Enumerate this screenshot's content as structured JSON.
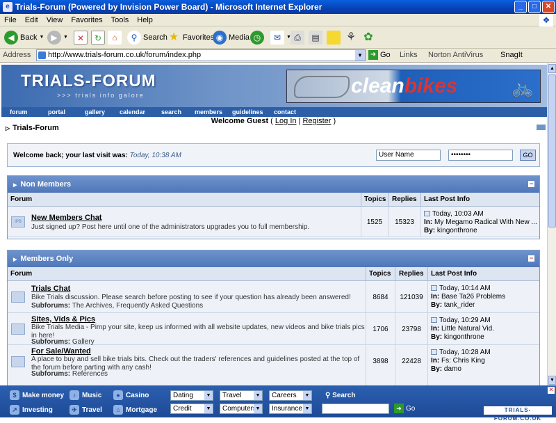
{
  "window": {
    "title": "Trials-Forum (Powered by Invision Power Board) - Microsoft Internet Explorer"
  },
  "menu": [
    "File",
    "Edit",
    "View",
    "Favorites",
    "Tools",
    "Help"
  ],
  "toolbar": {
    "back": "Back",
    "search": "Search",
    "favorites": "Favorites",
    "media": "Media"
  },
  "address": {
    "label": "Address",
    "url": "http://www.trials-forum.co.uk/forum/index.php",
    "go": "Go",
    "links": "Links",
    "norton": "Norton AntiVirus",
    "snagit": "SnagIt"
  },
  "banner": {
    "logo": "TRIALS-FORUM",
    "logo_sub": ">>> trials info galore",
    "ad_clean": "clean",
    "ad_bikes": "bikes"
  },
  "nav": [
    "forum",
    "portal",
    "gallery",
    "calendar",
    "search",
    "members",
    "guidelines",
    "contact"
  ],
  "guest": {
    "welcome": "Welcome Guest",
    "login": "Log In",
    "register": "Register"
  },
  "breadcrumb": "Trials-Forum",
  "login": {
    "msg": "Welcome back; your last visit was:",
    "last_visit": "Today, 10:38 AM",
    "username": "User Name",
    "password": "••••••••",
    "go": "GO"
  },
  "categories": [
    {
      "name": "Non Members",
      "columns": {
        "forum": "Forum",
        "topics": "Topics",
        "replies": "Replies",
        "last": "Last Post Info"
      },
      "forums": [
        {
          "title": "New Members Chat",
          "desc": "Just signed up? Post here until one of the administrators upgrades you to full membership.",
          "topics": "1525",
          "replies": "15323",
          "lp_time": "Today, 10:03 AM",
          "lp_in_label": "In:",
          "lp_in": "My Megamo Radical With New ...",
          "lp_by_label": "By:",
          "lp_by": "kingonthrone"
        }
      ]
    },
    {
      "name": "Members Only",
      "columns": {
        "forum": "Forum",
        "topics": "Topics",
        "replies": "Replies",
        "last": "Last Post Info"
      },
      "forums": [
        {
          "title": "Trials Chat",
          "desc1": "Bike Trials discussion. Please ",
          "desc_link": "search",
          "desc2": " before posting to see if your question has already been answered!",
          "sub_label": "Subforums:",
          "subs": [
            "The Archives",
            "Frequently Asked Questions"
          ],
          "topics": "8684",
          "replies": "121039",
          "lp_time": "Today, 10:14 AM",
          "lp_in_label": "In:",
          "lp_in": "Base Ta26 Problems",
          "lp_by_label": "By:",
          "lp_by": "tank_rider"
        },
        {
          "title": "Sites, Vids & Pics",
          "desc": "Bike Trials Media - Pimp your site, keep us informed with all website updates, new videos and bike trials pics in here!",
          "sub_label": "Subforums:",
          "subs": [
            "Gallery"
          ],
          "topics": "1706",
          "replies": "23798",
          "lp_time": "Today, 10:29 AM",
          "lp_in_label": "In:",
          "lp_in": "Little Natural Vid.",
          "lp_by_label": "By:",
          "lp_by": "kingonthrone"
        },
        {
          "title": "For Sale/Wanted",
          "desc": "A place to buy and sell bike trials bits. Check out the traders' references and guidelines posted at the top of the forum before parting with any cash!",
          "sub_label": "Subforums:",
          "subs": [
            "References"
          ],
          "topics": "3898",
          "replies": "22428",
          "lp_time": "Today, 10:28 AM",
          "lp_in_label": "In:",
          "lp_in": "Fs: Chris King",
          "lp_by_label": "By:",
          "lp_by": "damo"
        }
      ]
    }
  ],
  "bottom": {
    "links": [
      "Make money",
      "Music",
      "Casino",
      "Investing",
      "Travel",
      "Mortgage"
    ],
    "selects": [
      "Dating",
      "Travel",
      "Careers",
      "Credit",
      "Computers",
      "Insurance"
    ],
    "search": "Search",
    "go": "Go",
    "brand": "TRIALS-FORUM.CO.UK"
  }
}
